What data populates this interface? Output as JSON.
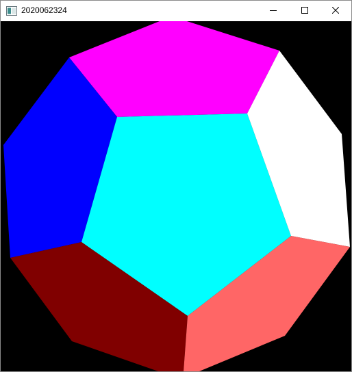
{
  "window": {
    "title": "2020062324",
    "controls": {
      "minimize_icon": "minimize-icon",
      "maximize_icon": "maximize-icon",
      "close_icon": "close-icon"
    }
  },
  "scene": {
    "background": "#000000",
    "faces": [
      {
        "name": "face-top",
        "color": "#ff00ff"
      },
      {
        "name": "face-left",
        "color": "#0000ff"
      },
      {
        "name": "face-center",
        "color": "#00ffff"
      },
      {
        "name": "face-right",
        "color": "#ffffff"
      },
      {
        "name": "face-bottom-left",
        "color": "#800000"
      },
      {
        "name": "face-bottom-right",
        "color": "#ff6666"
      }
    ]
  }
}
